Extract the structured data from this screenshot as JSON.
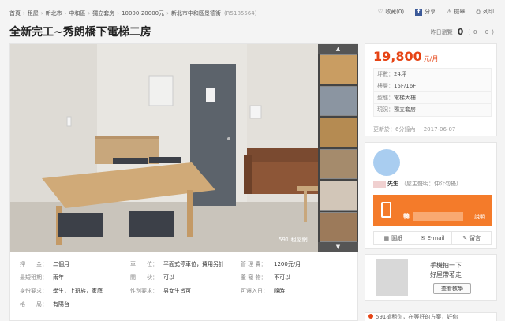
{
  "breadcrumb": {
    "items": [
      "首頁",
      "租屋",
      "新北市",
      "中和區",
      "獨立套房",
      "10000-20000元",
      "新北市中和區景德街"
    ],
    "listing_id": "(R5185564)"
  },
  "top_actions": {
    "favorite": "收藏(0)",
    "share": "分享",
    "report": "檢舉",
    "print": "列印"
  },
  "title": "全新完工~秀朗橋下電梯二房",
  "views": {
    "label": "昨日瀏覽",
    "count": "0",
    "extra": "(",
    "extra_count1": "0",
    "extra_count2": "0",
    "extra_end": ")"
  },
  "gallery": {
    "arrow_up": "▲",
    "arrow_down": "▼",
    "watermark": "591 租屋網"
  },
  "details": {
    "rows": [
      [
        {
          "k": "押　　金：",
          "v": "二個月"
        },
        {
          "k": "車　　位：",
          "v": "平面式停車位，費用另計"
        },
        {
          "k": "管 理 費：",
          "v": "1200元/月"
        }
      ],
      [
        {
          "k": "最短租期：",
          "v": "兩年"
        },
        {
          "k": "開　　伙：",
          "v": "可以"
        },
        {
          "k": "養 寵 物：",
          "v": "不可以"
        }
      ],
      [
        {
          "k": "身份要求：",
          "v": "學生，上班族，家庭"
        },
        {
          "k": "性別要求：",
          "v": "男女生皆可"
        },
        {
          "k": "可遷入日：",
          "v": "隨時"
        }
      ],
      [
        {
          "k": "格　　局：",
          "v": "有陽台"
        }
      ]
    ]
  },
  "info": {
    "price": "19,800",
    "price_unit": "元/月",
    "specs": [
      {
        "k": "坪數：",
        "v": "24坪"
      },
      {
        "k": "樓層：",
        "v": "15F/16F"
      },
      {
        "k": "型態：",
        "v": "電梯大樓"
      },
      {
        "k": "現況：",
        "v": "獨立套房"
      }
    ],
    "updated_label": "更新於：",
    "updated_ago": "6分鐘內",
    "updated_date": "2017-06-07"
  },
  "agent": {
    "name": "先生",
    "role": "（屋主聲明：仲介勿擾）",
    "call_prefix": "韓",
    "call_desc": "說明",
    "actions": [
      "圖紙",
      "E-mail",
      "留言"
    ]
  },
  "app": {
    "line1": "手機拍一下",
    "line2": "好屋帶著走",
    "button": "查看教學"
  },
  "news": {
    "text": "591搶租你，在等好的方案，好你"
  },
  "colors": {
    "accent": "#e64415",
    "call_button": "#f47b2a"
  }
}
